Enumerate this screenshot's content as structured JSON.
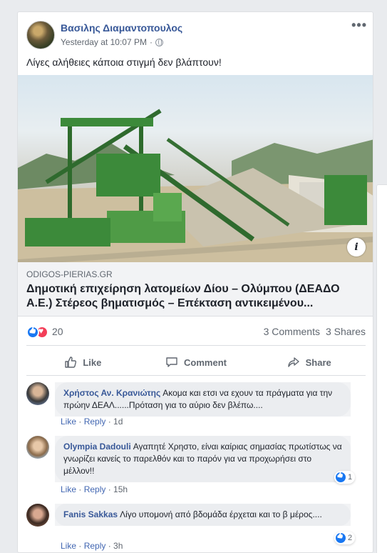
{
  "post": {
    "author": "Βασιλης Διαμαντοπουλος",
    "timestamp": "Yesterday at 10:07 PM",
    "separator": "·",
    "more_label": "•••",
    "text": "Λίγες αλήθειες κάποια στιγμή δεν βλάπτουν!"
  },
  "link": {
    "domain": "ODIGOS-PIERIAS.GR",
    "title": "Δημοτική επιχείρηση λατομείων Δίου – Ολύμπου (ΔΕΑΔΟ Α.Ε.) Στέρεος βηματισμός – Επέκταση αντικειμένου...",
    "info_label": "i"
  },
  "stats": {
    "reactions_count": "20",
    "comments": "3 Comments",
    "shares": "3 Shares"
  },
  "actions": {
    "like": "Like",
    "comment": "Comment",
    "share": "Share",
    "like_icon": "thumbs-up-icon",
    "comment_icon": "speech-bubble-icon",
    "share_icon": "share-arrow-icon"
  },
  "comments": [
    {
      "name": "Χρήστος Αν. Κρανιώτης",
      "text": "Ακομα και ετσι να εχουν τα πράγματα για την πρώην ΔΕΑΛ......Πρόταση για το αύριο δεν βλέπω....",
      "like": "Like",
      "reply": "Reply",
      "time": "1d",
      "reactions": ""
    },
    {
      "name": "Olympia Dadouli",
      "text": "Αγαπητέ Χρηστο, είναι καίριας σημασίας πρωτίστως να γνωρίζει κανείς το παρελθόν και το παρόν για να προχωρήσει στο μέλλον!!",
      "like": "Like",
      "reply": "Reply",
      "time": "15h",
      "reactions": "1"
    },
    {
      "name": "Fanis Sakkas",
      "text": "Λίγο υπομονή από βδομάδα έρχεται και το β μέρος....",
      "like": "Like",
      "reply": "Reply",
      "time": "3h",
      "reactions": "2"
    }
  ],
  "colors": {
    "link_blue": "#385898",
    "like_blue": "#1877f2",
    "love_red": "#f33e58",
    "machinery_green": "#3c8a3a"
  }
}
